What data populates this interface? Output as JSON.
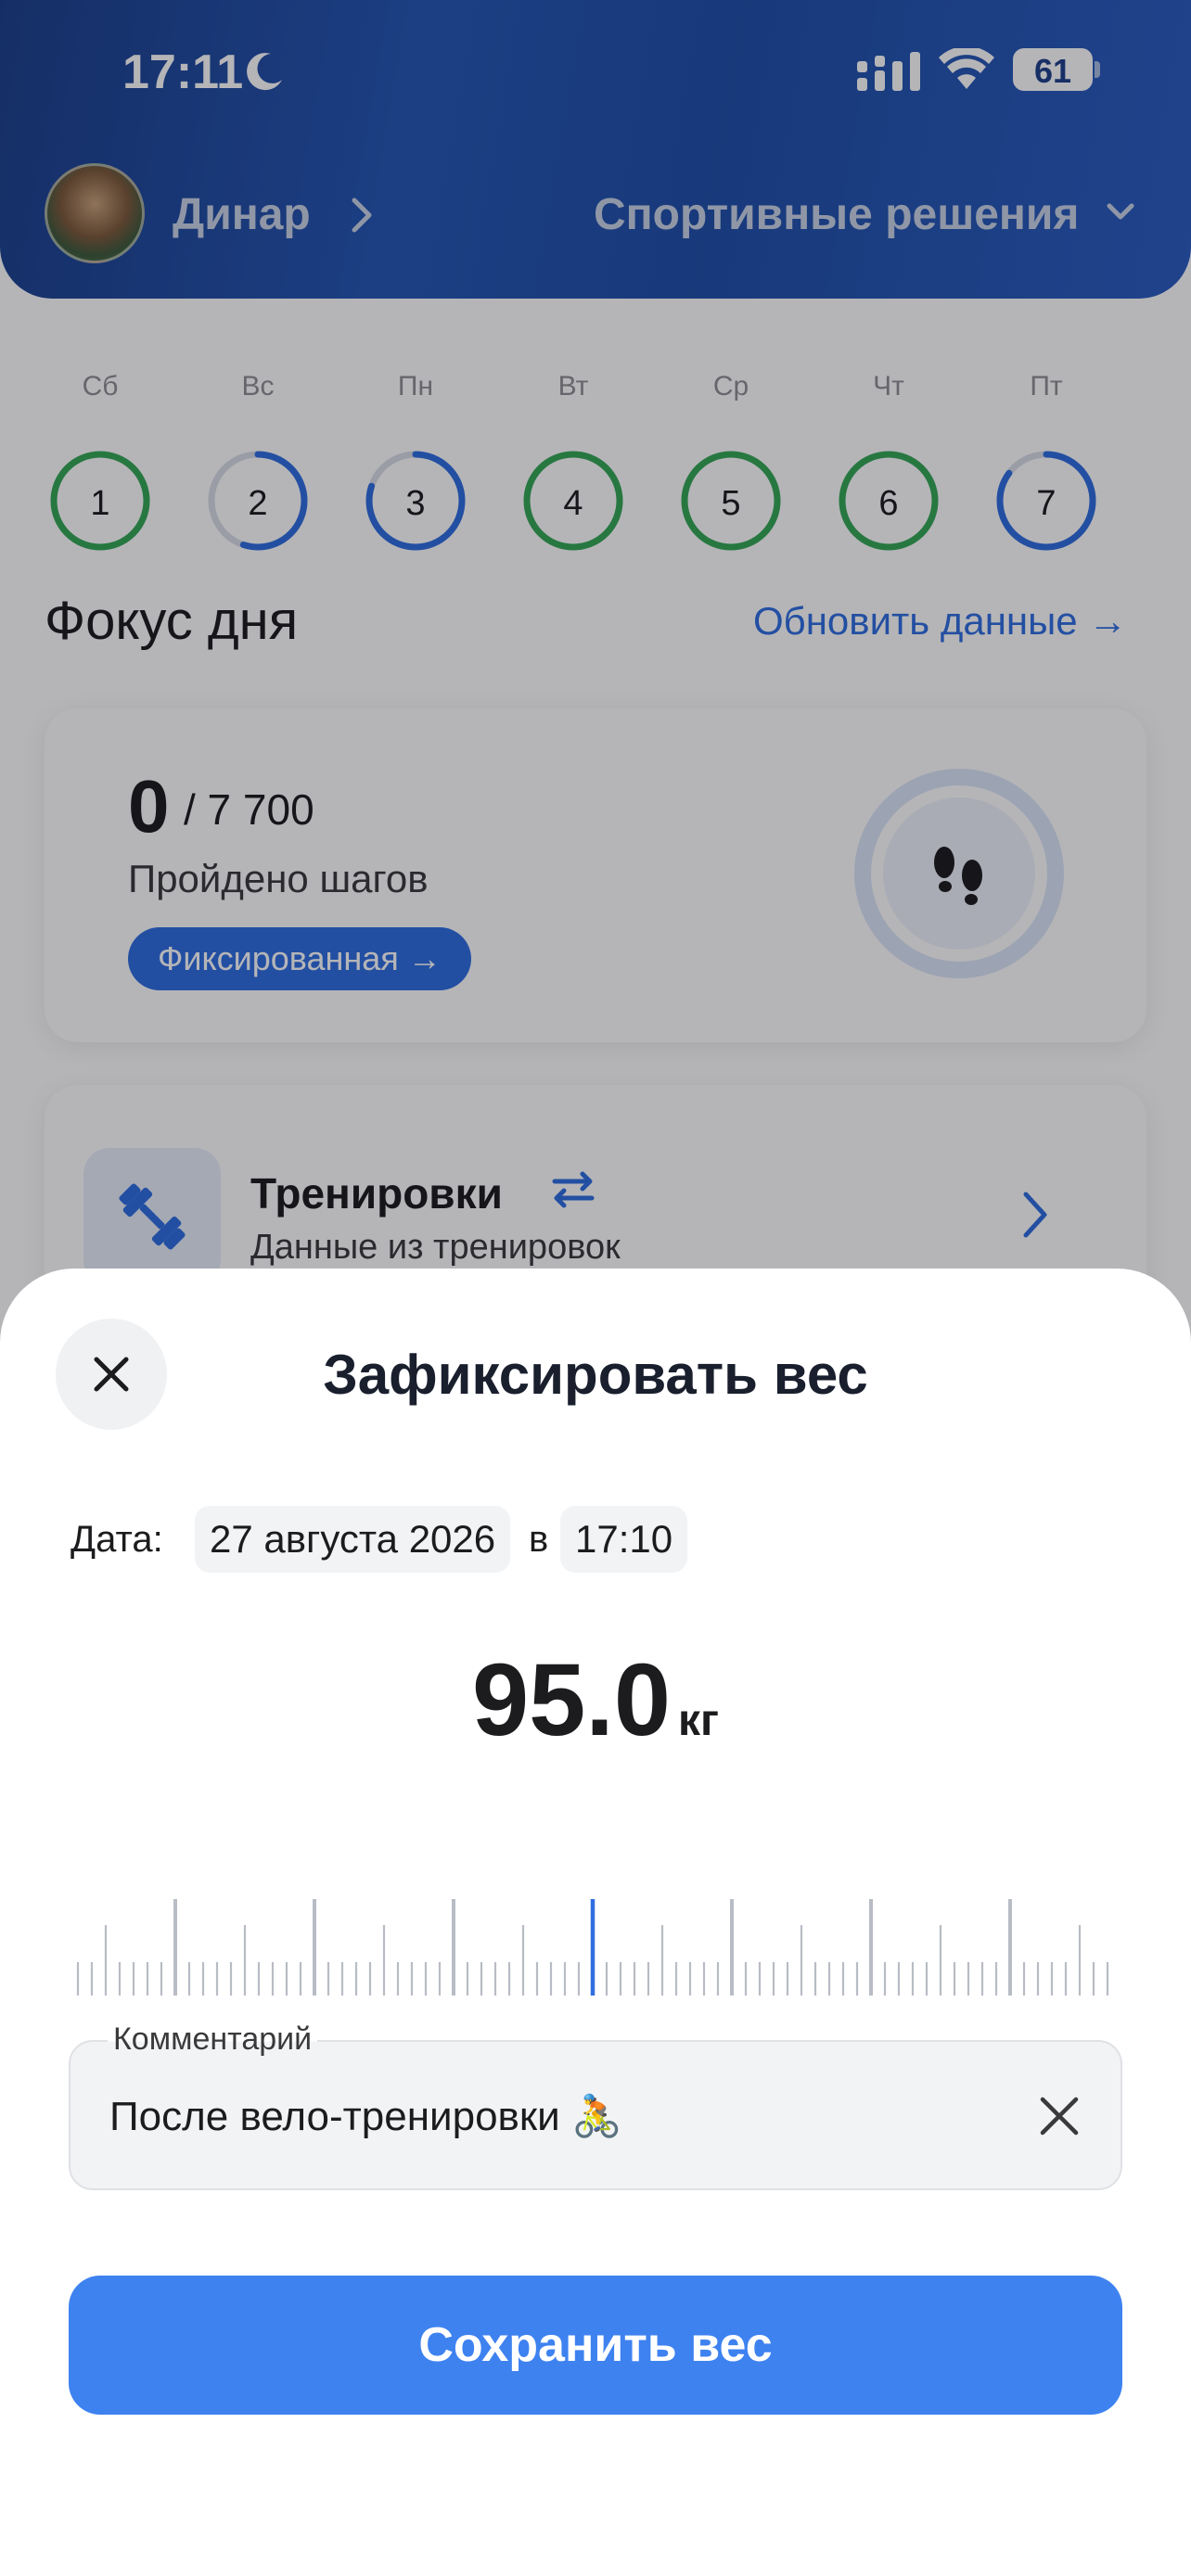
{
  "status_bar": {
    "time": "17:11",
    "battery": "61"
  },
  "header": {
    "user_name": "Динар",
    "organization": "Спортивные решения"
  },
  "week": [
    {
      "label": "Сб",
      "day": "1",
      "progress": 1.0,
      "color": "#34a853"
    },
    {
      "label": "Вс",
      "day": "2",
      "progress": 0.55,
      "color": "#2f6ee0"
    },
    {
      "label": "Пн",
      "day": "3",
      "progress": 0.8,
      "color": "#2f6ee0"
    },
    {
      "label": "Вт",
      "day": "4",
      "progress": 1.0,
      "color": "#34a853"
    },
    {
      "label": "Ср",
      "day": "5",
      "progress": 1.0,
      "color": "#34a853"
    },
    {
      "label": "Чт",
      "day": "6",
      "progress": 1.0,
      "color": "#34a853"
    },
    {
      "label": "Пт",
      "day": "7",
      "progress": 0.85,
      "color": "#2f6ee0"
    }
  ],
  "focus": {
    "title": "Фокус дня",
    "refresh": "Обновить данные →",
    "steps_value": "0",
    "steps_goal": "/ 7 700",
    "steps_label": "Пройдено шагов",
    "steps_chip": "Фиксированная →"
  },
  "training": {
    "title": "Тренировки",
    "subtitle": "Данные из тренировок"
  },
  "sheet": {
    "title": "Зафиксировать вес",
    "date_label": "Дата:",
    "date": "27 августа 2026",
    "date_sep": "в",
    "time": "17:10",
    "weight": "95.0",
    "unit": "кг",
    "comment_label": "Комментарий",
    "comment_value": "После вело-тренировки 🚴",
    "save": "Сохранить вес"
  },
  "colors": {
    "accent": "#3e82f0",
    "link": "#2f6ee0",
    "success": "#34a853",
    "ruler_tick": "#b8bcc4",
    "ruler_selected": "#2f6ee0"
  }
}
